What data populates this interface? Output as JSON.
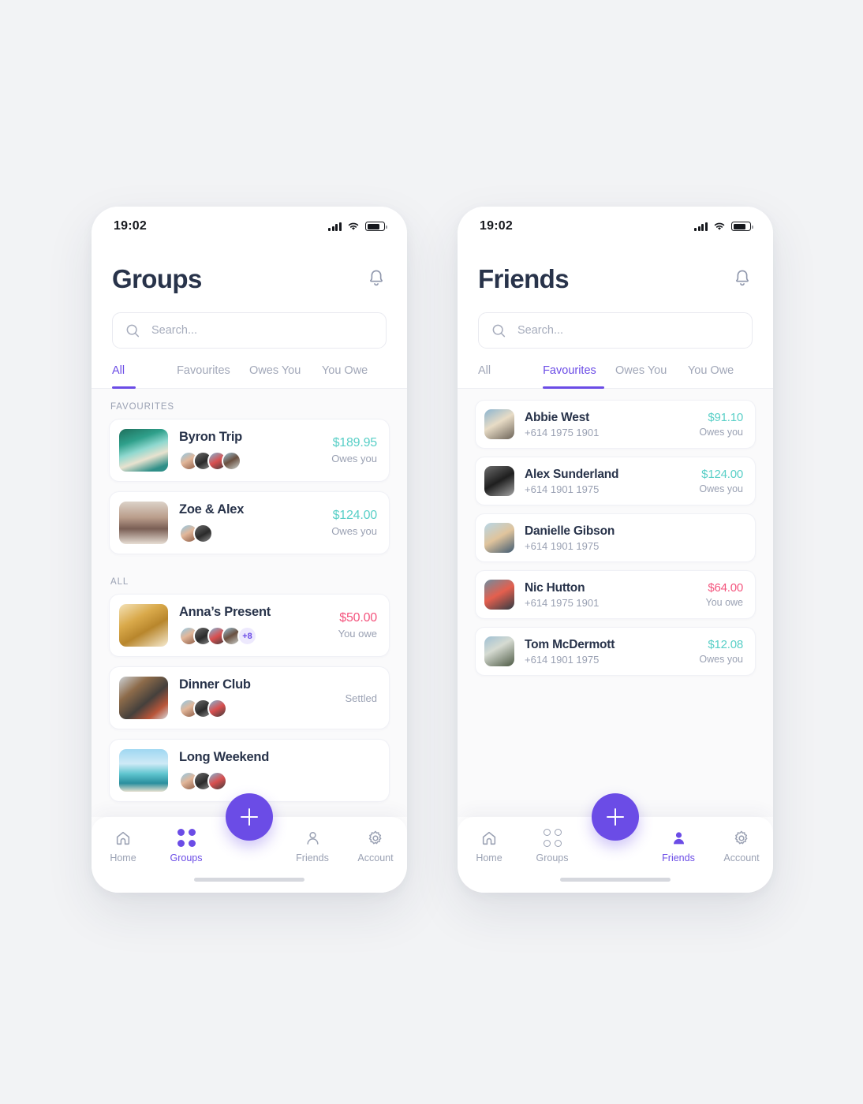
{
  "theme": {
    "accent": "#6B4CE6",
    "owed_color": "#59CFC7",
    "owing_color": "#F4557E",
    "title_color": "#28334A",
    "muted_color": "#9AA1B3",
    "background": "#F2F3F5"
  },
  "statusbar": {
    "time": "19:02",
    "signal_icon": "cellular-bars-icon",
    "wifi_icon": "wifi-icon",
    "battery_icon": "battery-icon"
  },
  "groups_screen": {
    "title": "Groups",
    "bell_icon": "notification-bell-icon",
    "search": {
      "value": "",
      "placeholder": "Search...",
      "icon": "search-icon"
    },
    "tabs": [
      {
        "label": "All",
        "active": true
      },
      {
        "label": "Favourites",
        "active": false
      },
      {
        "label": "Owes You",
        "active": false
      },
      {
        "label": "You Owe",
        "active": false
      }
    ],
    "sections": [
      {
        "label": "FAVOURITES",
        "items": [
          {
            "name": "Byron Trip",
            "amount": "$189.95",
            "sublabel": "Owes you",
            "state": "owed",
            "member_count": 4,
            "extra_members": null
          },
          {
            "name": "Zoe & Alex",
            "amount": "$124.00",
            "sublabel": "Owes you",
            "state": "owed",
            "member_count": 2,
            "extra_members": null
          }
        ]
      },
      {
        "label": "ALL",
        "items": [
          {
            "name": "Anna’s Present",
            "amount": "$50.00",
            "sublabel": "You owe",
            "state": "owing",
            "member_count": 4,
            "extra_members": "+8"
          },
          {
            "name": "Dinner Club",
            "amount": "",
            "sublabel": "",
            "state": "settled",
            "settled_label": "Settled",
            "member_count": 3,
            "extra_members": null
          },
          {
            "name": "Long Weekend",
            "amount": "",
            "sublabel": "",
            "state": "none",
            "member_count": 3,
            "extra_members": null
          }
        ]
      }
    ],
    "fab": {
      "label": "+",
      "icon": "plus-icon"
    },
    "nav": [
      {
        "label": "Home",
        "icon": "home-icon",
        "active": false
      },
      {
        "label": "Groups",
        "icon": "groups-dots-icon",
        "active": true
      },
      {
        "label": "Friends",
        "icon": "person-icon",
        "active": false
      },
      {
        "label": "Account",
        "icon": "gear-icon",
        "active": false
      }
    ]
  },
  "friends_screen": {
    "title": "Friends",
    "bell_icon": "notification-bell-icon",
    "search": {
      "value": "",
      "placeholder": "Search...",
      "icon": "search-icon"
    },
    "tabs": [
      {
        "label": "All",
        "active": false
      },
      {
        "label": "Favourites",
        "active": true
      },
      {
        "label": "Owes You",
        "active": false
      },
      {
        "label": "You Owe",
        "active": false
      }
    ],
    "friends": [
      {
        "name": "Abbie West",
        "phone": "+614 1975 1901",
        "amount": "$91.10",
        "sublabel": "Owes you",
        "state": "owed"
      },
      {
        "name": "Alex Sunderland",
        "phone": "+614 1901 1975",
        "amount": "$124.00",
        "sublabel": "Owes you",
        "state": "owed"
      },
      {
        "name": "Danielle Gibson",
        "phone": "+614 1901 1975",
        "amount": "",
        "sublabel": "",
        "state": "none"
      },
      {
        "name": "Nic Hutton",
        "phone": "+614 1975 1901",
        "amount": "$64.00",
        "sublabel": "You owe",
        "state": "owing"
      },
      {
        "name": "Tom McDermott",
        "phone": "+614 1901 1975",
        "amount": "$12.08",
        "sublabel": "Owes you",
        "state": "owed"
      }
    ],
    "fab": {
      "label": "+",
      "icon": "plus-icon"
    },
    "nav": [
      {
        "label": "Home",
        "icon": "home-icon",
        "active": false
      },
      {
        "label": "Groups",
        "icon": "groups-dots-icon",
        "active": false
      },
      {
        "label": "Friends",
        "icon": "person-icon",
        "active": true
      },
      {
        "label": "Account",
        "icon": "gear-icon",
        "active": false
      }
    ]
  }
}
